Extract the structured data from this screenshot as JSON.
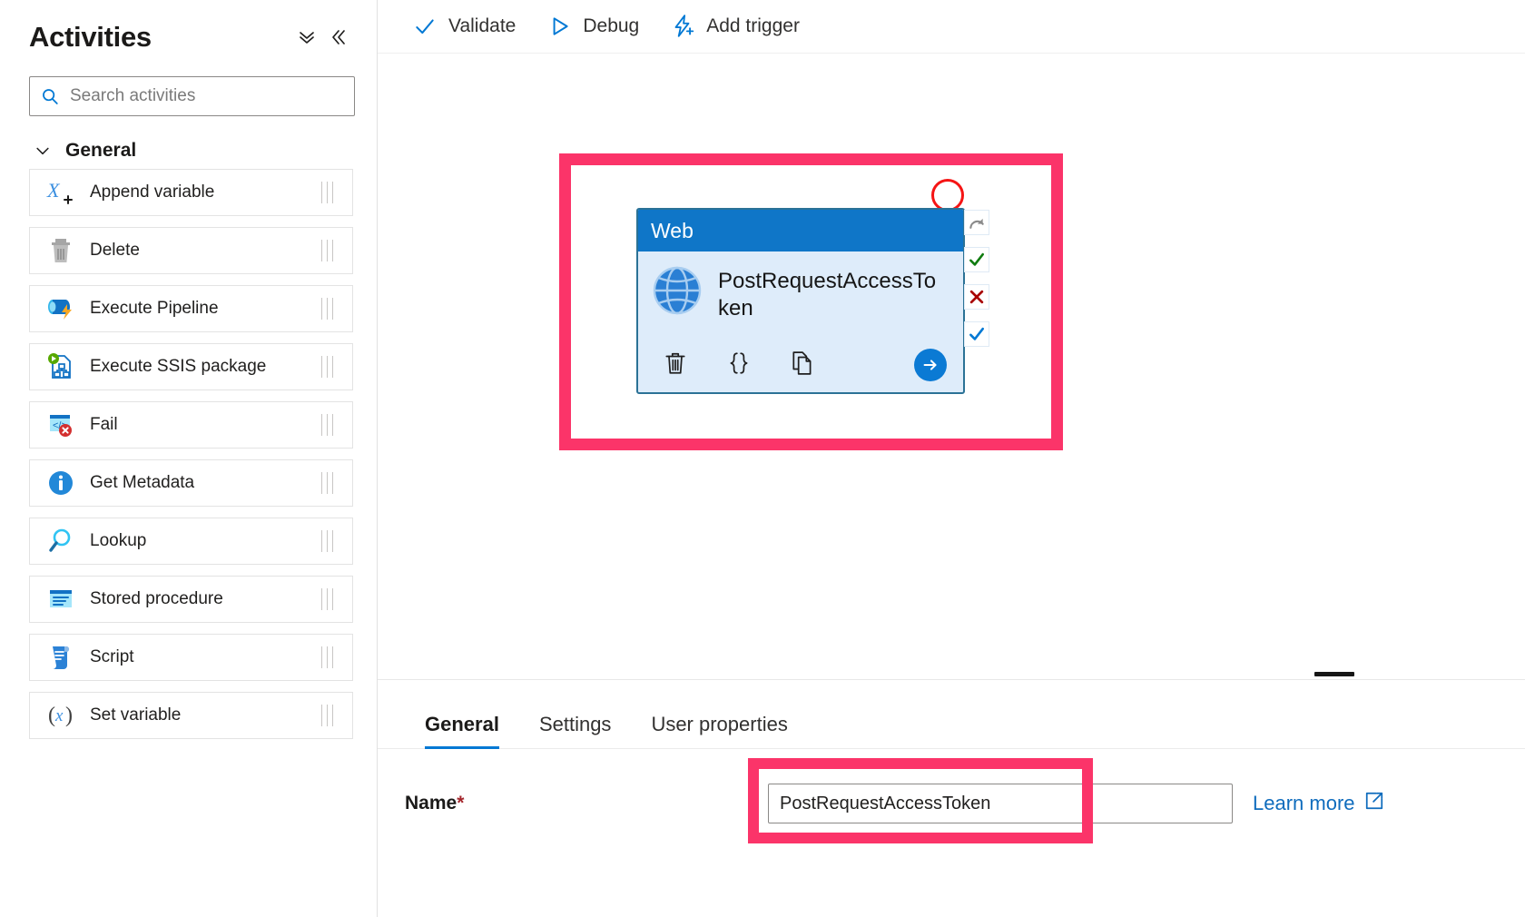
{
  "sidebar": {
    "title": "Activities",
    "header_icons": [
      {
        "name": "expand-all-icon",
        "glyph": "chevron-double-down"
      },
      {
        "name": "collapse-panel-icon",
        "glyph": "chevron-double-left"
      }
    ],
    "search": {
      "placeholder": "Search activities",
      "value": "",
      "icon": "search-icon"
    },
    "group": {
      "label": "General",
      "expanded": true,
      "chevron": "chevron-down-icon"
    },
    "items": [
      {
        "label": "Append variable",
        "icon": "append-variable-icon"
      },
      {
        "label": "Delete",
        "icon": "delete-trash-icon"
      },
      {
        "label": "Execute Pipeline",
        "icon": "execute-pipeline-icon"
      },
      {
        "label": "Execute SSIS package",
        "icon": "execute-ssis-package-icon"
      },
      {
        "label": "Fail",
        "icon": "fail-icon"
      },
      {
        "label": "Get Metadata",
        "icon": "get-metadata-icon"
      },
      {
        "label": "Lookup",
        "icon": "lookup-icon"
      },
      {
        "label": "Stored procedure",
        "icon": "stored-procedure-icon"
      },
      {
        "label": "Script",
        "icon": "script-icon"
      },
      {
        "label": "Set variable",
        "icon": "set-variable-icon"
      }
    ]
  },
  "toolbar": {
    "validate_label": "Validate",
    "debug_label": "Debug",
    "add_trigger_label": "Add trigger",
    "icons": {
      "validate": "checkmark-icon",
      "debug": "play-triangle-icon",
      "add_trigger": "lightning-plus-icon"
    }
  },
  "canvas": {
    "node": {
      "type_label": "Web",
      "activity_name": "PostRequestAccessToken",
      "icon": "web-globe-icon",
      "header_color": "#0f76c8",
      "body_color": "#deecfa",
      "border_color": "#2b7296",
      "actions": [
        {
          "name": "delete-activity-icon",
          "glyph": "trash"
        },
        {
          "name": "code-braces-icon",
          "glyph": "{ }"
        },
        {
          "name": "clone-activity-icon",
          "glyph": "copy"
        },
        {
          "name": "run-activity-icon",
          "glyph": "arrow-right"
        }
      ],
      "connectors": [
        {
          "name": "dependency-skipped-icon",
          "title": "Skipped",
          "color": "#8a8a8a"
        },
        {
          "name": "dependency-success-icon",
          "title": "Success",
          "color": "#107c10"
        },
        {
          "name": "dependency-failure-icon",
          "title": "Failure",
          "color": "#a80000"
        },
        {
          "name": "dependency-completion-icon",
          "title": "Completion",
          "color": "#0078d4"
        }
      ]
    },
    "annotations": {
      "highlight_color": "#fb3469",
      "circle_color": "#f51414"
    }
  },
  "panel": {
    "tabs": [
      {
        "label": "General",
        "active": true
      },
      {
        "label": "Settings",
        "active": false
      },
      {
        "label": "User properties",
        "active": false
      }
    ],
    "name_field": {
      "label": "Name",
      "required_marker": "*",
      "value": "PostRequestAccessToken",
      "placeholder": ""
    },
    "learn_more": {
      "label": "Learn more",
      "icon": "external-link-icon"
    }
  }
}
